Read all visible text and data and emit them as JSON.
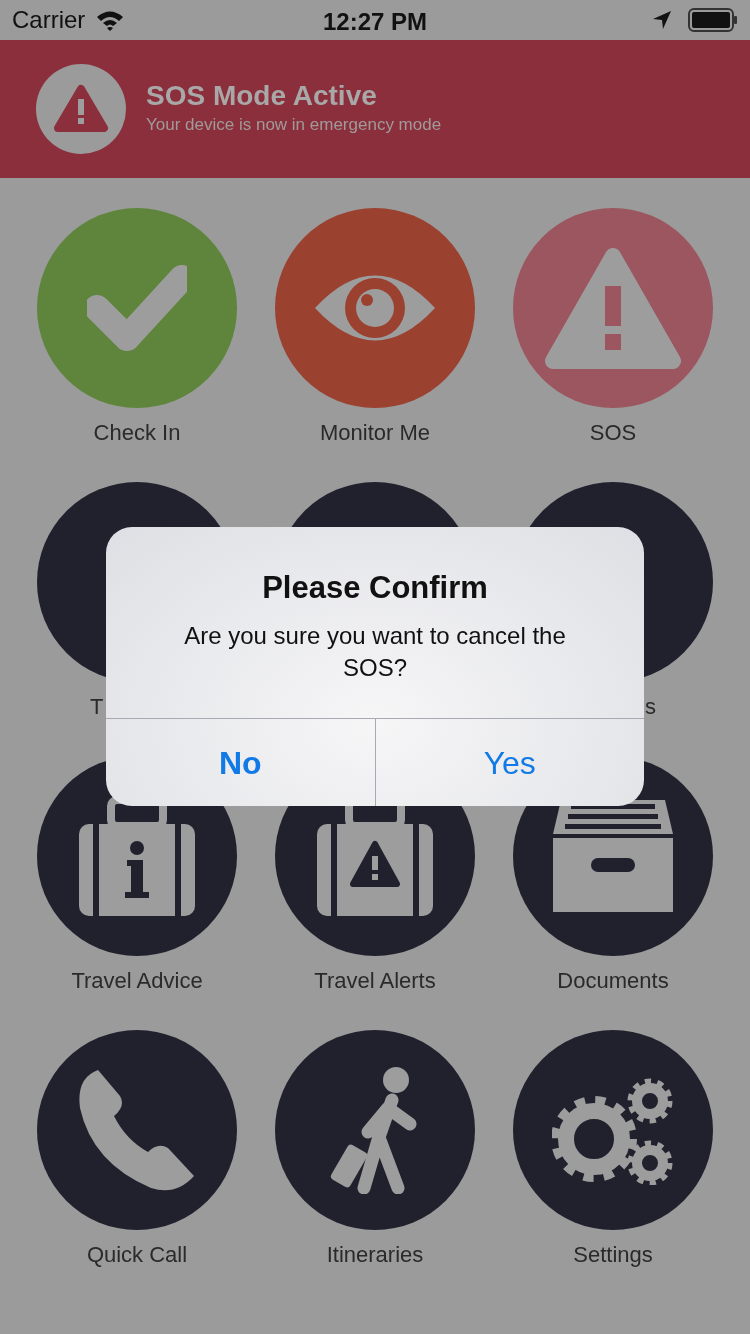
{
  "status_bar": {
    "carrier": "Carrier",
    "time": "12:27 PM"
  },
  "banner": {
    "title": "SOS Mode Active",
    "subtitle": "Your device is now in emergency mode"
  },
  "tiles": [
    {
      "label": "Check In",
      "kind": "check",
      "color": "#5e853b"
    },
    {
      "label": "Monitor Me",
      "kind": "eye",
      "color": "#9a4130"
    },
    {
      "label": "SOS",
      "kind": "warning",
      "color": "#9b5660"
    },
    {
      "label": "T",
      "kind": "covered",
      "color": "#20212d"
    },
    {
      "kind": "covered",
      "color": "#20212d"
    },
    {
      "label": "s",
      "kind": "covered",
      "color": "#20212d"
    },
    {
      "label": "Travel Advice",
      "kind": "briefcase-info",
      "color": "#20212d"
    },
    {
      "label": "Travel Alerts",
      "kind": "briefcase-alert",
      "color": "#20212d"
    },
    {
      "label": "Documents",
      "kind": "archive",
      "color": "#20212d"
    },
    {
      "label": "Quick Call",
      "kind": "phone",
      "color": "#20212d"
    },
    {
      "label": "Itineraries",
      "kind": "traveler",
      "color": "#20212d"
    },
    {
      "label": "Settings",
      "kind": "gears",
      "color": "#20212d"
    }
  ],
  "dialog": {
    "title": "Please Confirm",
    "message": "Are you sure you want to cancel the SOS?",
    "buttons": [
      {
        "label": "No",
        "bold": true
      },
      {
        "label": "Yes",
        "bold": false
      }
    ]
  }
}
